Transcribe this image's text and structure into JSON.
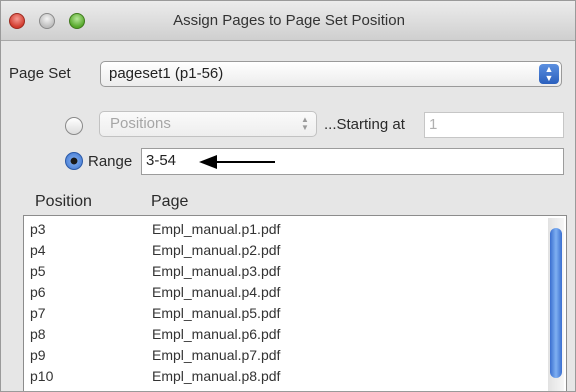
{
  "window": {
    "title": "Assign Pages to Page Set Position"
  },
  "page_set": {
    "label": "Page Set",
    "value": "pageset1 (p1-56)"
  },
  "positions": {
    "option_label": "Positions",
    "starting_label": "...Starting at",
    "starting_value": "1"
  },
  "range": {
    "label": "Range",
    "value": "3-54"
  },
  "table": {
    "headers": [
      "Position",
      "Page"
    ],
    "rows": [
      [
        "p3",
        "Empl_manual.p1.pdf"
      ],
      [
        "p4",
        "Empl_manual.p2.pdf"
      ],
      [
        "p5",
        "Empl_manual.p3.pdf"
      ],
      [
        "p6",
        "Empl_manual.p4.pdf"
      ],
      [
        "p7",
        "Empl_manual.p5.pdf"
      ],
      [
        "p8",
        "Empl_manual.p6.pdf"
      ],
      [
        "p9",
        "Empl_manual.p7.pdf"
      ],
      [
        "p10",
        "Empl_manual.p8.pdf"
      ]
    ]
  },
  "icons": {
    "window_controls": [
      "close-icon",
      "minimize-icon",
      "zoom-icon"
    ],
    "popup_arrows": "updown-arrows-icon",
    "annotation": "left-arrow-icon"
  },
  "colors": {
    "accent": "#3d73cc",
    "scroll_thumb": "#5a8fe2"
  }
}
